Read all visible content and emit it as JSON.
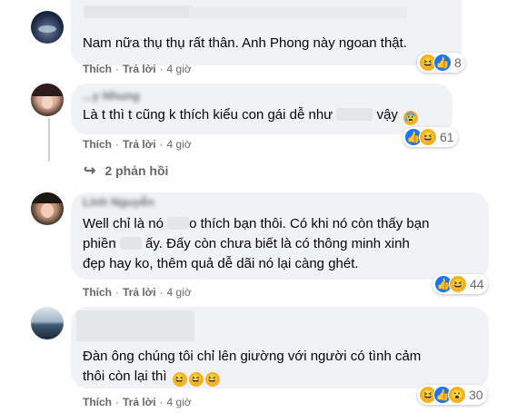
{
  "comments": [
    {
      "text_lines": [
        "Nam nữa thụ thụ rất thân. Anh Phong này ngoan thật."
      ],
      "actions": {
        "like": "Thích",
        "reply": "Trả lời",
        "time": "4 giờ"
      },
      "reaction_count": "8"
    },
    {
      "name": "...y Nhung",
      "text_lines": [
        "Là t thì t cũng k thích kiểu con gái dễ như",
        "vậy"
      ],
      "actions": {
        "like": "Thích",
        "reply": "Trả lời",
        "time": "4 giờ"
      },
      "reaction_count": "61",
      "replies_label": "2 phản hồi"
    },
    {
      "name": "Linh Nguyễn",
      "text_lines": [
        "Well chỉ là nó",
        "o thích bạn thôi. Có khi nó còn thấy bạn",
        "phiền",
        "ấy. Đấy còn chưa biết là có thông minh xinh",
        "đẹp hay ko, thêm quả dễ dãi nó lại càng ghét."
      ],
      "actions": {
        "like": "Thích",
        "reply": "Trả lời",
        "time": "4 giờ"
      },
      "reaction_count": "44"
    },
    {
      "text_lines": [
        "Đàn ông chúng tôi chỉ lên giường với người có tình cảm",
        "thôi còn lại thì"
      ],
      "actions": {
        "like": "Thích",
        "reply": "Trả lời",
        "time": "4 giờ"
      },
      "reaction_count": "30"
    }
  ],
  "colors": {
    "bubble": "#f0f2f5",
    "meta_text": "#65676b",
    "like_blue": "#1877f2",
    "haha_yellow": "#f7b125"
  }
}
